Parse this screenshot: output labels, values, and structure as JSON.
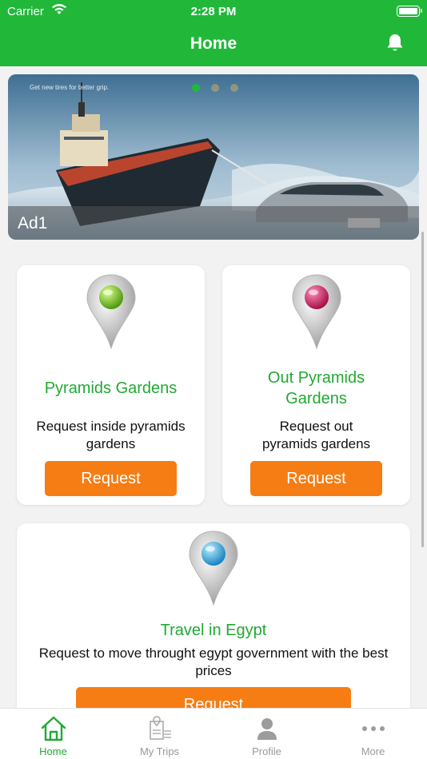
{
  "status_bar": {
    "carrier": "Carrier",
    "time": "2:28 PM"
  },
  "header": {
    "title": "Home",
    "accent": "#21b83a"
  },
  "ad": {
    "label": "Ad1",
    "tagline": "Get new tires for better grip.",
    "page_count": 3,
    "active_page": 1
  },
  "cards": [
    {
      "title": "Pyramids Gardens",
      "description": "Request inside pyramids gardens",
      "button": "Request",
      "pin_color": "#7ed321"
    },
    {
      "title": "Out Pyramids Gardens",
      "description": "Request out pyramids gardens",
      "button": "Request",
      "pin_color": "#e0246b"
    },
    {
      "title": "Travel in Egypt",
      "description": "Request to move throught egypt government with the best prices",
      "button": "Request",
      "pin_color": "#3aaee8"
    }
  ],
  "tabs": [
    {
      "label": "Home",
      "icon": "home-icon",
      "active": true
    },
    {
      "label": "My Trips",
      "icon": "trips-icon",
      "active": false
    },
    {
      "label": "Profile",
      "icon": "profile-icon",
      "active": false
    },
    {
      "label": "More",
      "icon": "more-icon",
      "active": false
    }
  ],
  "colors": {
    "button": "#f67d13",
    "title_green": "#21a934"
  }
}
